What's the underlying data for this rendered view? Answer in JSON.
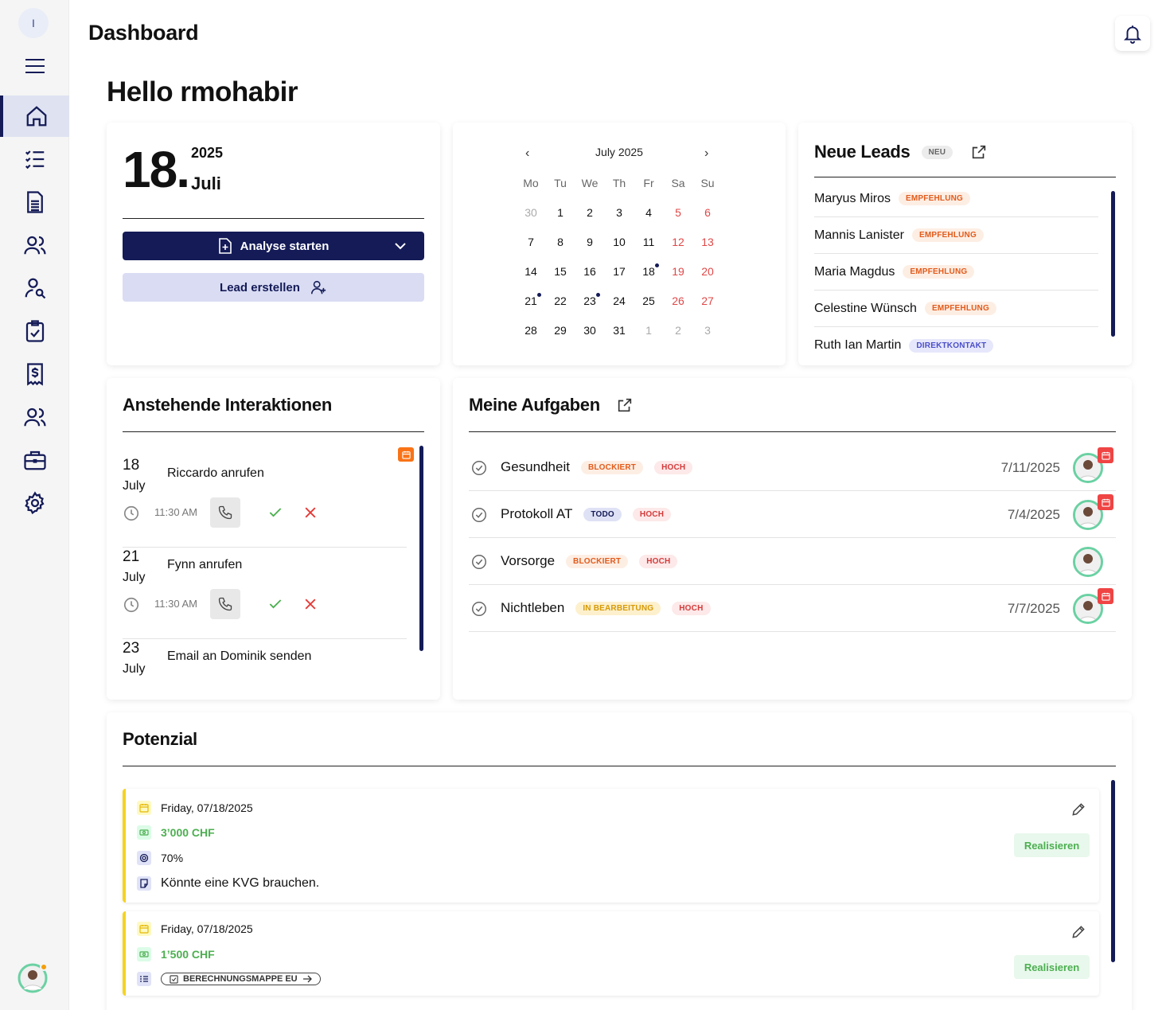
{
  "sidebar": {
    "top_badge": "I",
    "items": [
      "home-icon",
      "tasks-list-icon",
      "document-icon",
      "users-icon",
      "user-search-icon",
      "clipboard-check-icon",
      "receipt-dollar-icon",
      "team-icon",
      "briefcase-icon",
      "gear-icon"
    ],
    "active_index": 0
  },
  "header": {
    "title": "Dashboard"
  },
  "greeting": "Hello rmohabir",
  "date_card": {
    "day": "18.",
    "year": "2025",
    "month": "Juli",
    "analyse_button": "Analyse starten",
    "lead_button": "Lead erstellen"
  },
  "calendar": {
    "title": "July 2025",
    "weekdays": [
      "Mo",
      "Tu",
      "We",
      "Th",
      "Fr",
      "Sa",
      "Su"
    ],
    "weeks": [
      [
        "30",
        "1",
        "2",
        "3",
        "4",
        "5",
        "6"
      ],
      [
        "7",
        "8",
        "9",
        "10",
        "11",
        "12",
        "13"
      ],
      [
        "14",
        "15",
        "16",
        "17",
        "18",
        "19",
        "20"
      ],
      [
        "21",
        "22",
        "23",
        "24",
        "25",
        "26",
        "27"
      ],
      [
        "28",
        "29",
        "30",
        "31",
        "1",
        "2",
        "3"
      ]
    ],
    "event_days": [
      "18",
      "21",
      "23"
    ]
  },
  "leads": {
    "title": "Neue Leads",
    "badge": "NEU",
    "items": [
      {
        "name": "Maryus Miros",
        "tag": "EMPFEHLUNG",
        "kind": "emp"
      },
      {
        "name": "Mannis Lanister",
        "tag": "EMPFEHLUNG",
        "kind": "emp"
      },
      {
        "name": "Maria Magdus",
        "tag": "EMPFEHLUNG",
        "kind": "emp"
      },
      {
        "name": "Celestine Wünsch",
        "tag": "EMPFEHLUNG",
        "kind": "emp"
      },
      {
        "name": "Ruth Ian Martin",
        "tag": "DIREKTKONTAKT",
        "kind": "dir"
      }
    ]
  },
  "interactions": {
    "title": "Anstehende Interaktionen",
    "items": [
      {
        "day": "18",
        "month": "July",
        "title": "Riccardo anrufen",
        "time": "11:30 AM"
      },
      {
        "day": "21",
        "month": "July",
        "title": "Fynn anrufen",
        "time": "11:30 AM"
      },
      {
        "day": "23",
        "month": "July",
        "title": "Email an Dominik senden",
        "time": ""
      }
    ]
  },
  "tasks": {
    "title": "Meine Aufgaben",
    "items": [
      {
        "name": "Gesundheit",
        "status": "BLOCKIERT",
        "status_kind": "blk",
        "priority": "HOCH",
        "date": "7/11/2025",
        "has_cal": true
      },
      {
        "name": "Protokoll AT",
        "status": "TODO",
        "status_kind": "todo",
        "priority": "HOCH",
        "date": "7/4/2025",
        "has_cal": true
      },
      {
        "name": "Vorsorge",
        "status": "BLOCKIERT",
        "status_kind": "blk",
        "priority": "HOCH",
        "date": "",
        "has_cal": false
      },
      {
        "name": "Nichtleben",
        "status": "IN BEARBEITUNG",
        "status_kind": "inb",
        "priority": "HOCH",
        "date": "7/7/2025",
        "has_cal": true
      }
    ]
  },
  "potential": {
    "title": "Potenzial",
    "items": [
      {
        "date": "Friday, 07/18/2025",
        "amount": "3’000 CHF",
        "percent": "70%",
        "note": "Könnte eine KVG brauchen.",
        "action": "Realisieren"
      },
      {
        "date": "Friday, 07/18/2025",
        "amount": "1’500 CHF",
        "tag": "BERECHNUNGSMAPPE EU",
        "action": "Realisieren"
      }
    ]
  },
  "colors": {
    "primary": "#141b57",
    "accent_light": "#d9dcf3",
    "weekend": "#e04848",
    "potential_border": "#f6d31e",
    "success": "#4caf50",
    "danger": "#e53935"
  }
}
